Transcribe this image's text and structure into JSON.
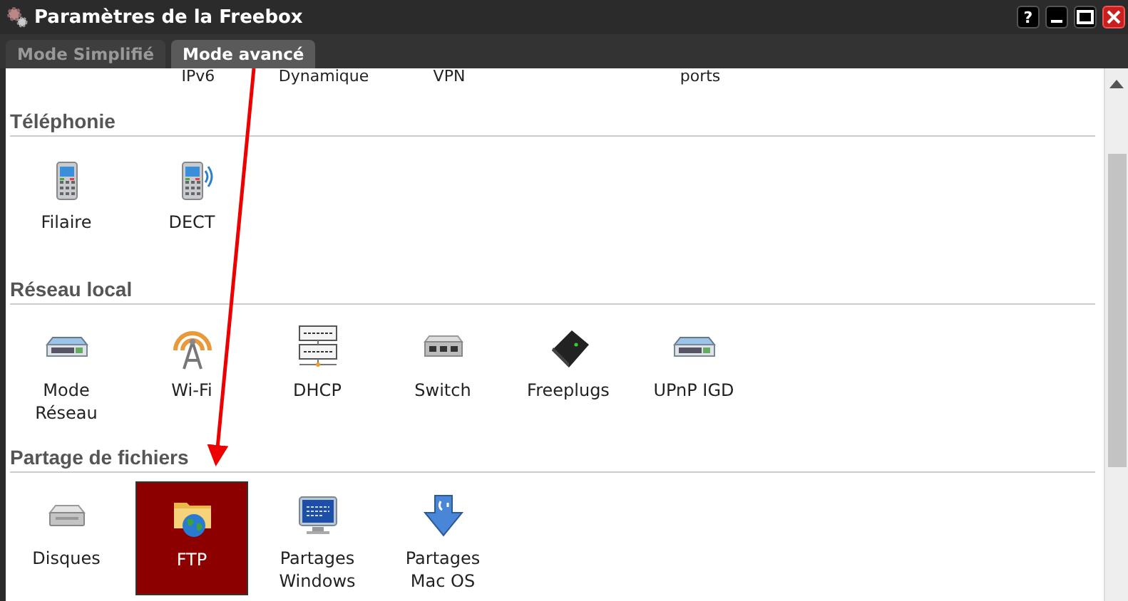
{
  "window": {
    "title": "Paramètres de la Freebox",
    "buttons": [
      "?"
    ]
  },
  "tabs": [
    {
      "label": "Mode Simplifié",
      "selected": false
    },
    {
      "label": "Mode avancé",
      "selected": true
    }
  ],
  "top_row": [
    "IPv6",
    "Dynamique",
    "VPN",
    "ports"
  ],
  "sections": [
    {
      "title": "Téléphonie",
      "items": [
        {
          "label": "Filaire",
          "selected": false
        },
        {
          "label": "DECT",
          "selected": false
        }
      ]
    },
    {
      "title": "Réseau local",
      "items": [
        {
          "label": "Mode\nRéseau",
          "selected": false
        },
        {
          "label": "Wi-Fi",
          "selected": false
        },
        {
          "label": "DHCP",
          "selected": false
        },
        {
          "label": "Switch",
          "selected": false
        },
        {
          "label": "Freeplugs",
          "selected": false
        },
        {
          "label": "UPnP IGD",
          "selected": false
        }
      ]
    },
    {
      "title": "Partage de fichiers",
      "items": [
        {
          "label": "Disques",
          "selected": false
        },
        {
          "label": "FTP",
          "selected": true
        },
        {
          "label": "Partages\nWindows",
          "selected": false
        },
        {
          "label": "Partages\nMac OS",
          "selected": false
        }
      ]
    }
  ]
}
